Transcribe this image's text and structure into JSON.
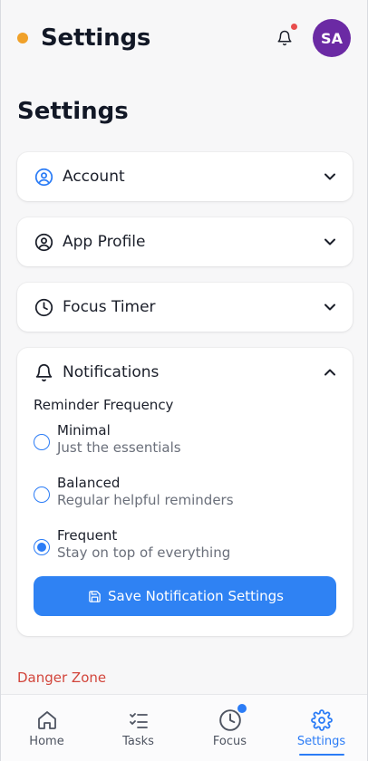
{
  "header": {
    "title": "Settings",
    "avatar_initials": "SA",
    "brand_dot_color": "#f0a12a",
    "notification_badge_color": "#e84d4d"
  },
  "page": {
    "title": "Settings"
  },
  "sections": {
    "account": {
      "label": "Account",
      "icon": "user-circle-icon"
    },
    "app_profile": {
      "label": "App Profile",
      "icon": "profile-icon"
    },
    "focus_timer": {
      "label": "Focus Timer",
      "icon": "clock-icon"
    },
    "notifications": {
      "label": "Notifications",
      "icon": "bell-icon",
      "frequency_label": "Reminder Frequency",
      "options": [
        {
          "title": "Minimal",
          "subtitle": "Just the essentials",
          "selected": false
        },
        {
          "title": "Balanced",
          "subtitle": "Regular helpful reminders",
          "selected": false
        },
        {
          "title": "Frequent",
          "subtitle": "Stay on top of everything",
          "selected": true
        }
      ],
      "save_label": "Save Notification Settings"
    }
  },
  "danger_zone": {
    "label": "Danger Zone"
  },
  "tabs": [
    {
      "label": "Home",
      "icon": "home-icon",
      "active": false
    },
    {
      "label": "Tasks",
      "icon": "tasks-icon",
      "active": false
    },
    {
      "label": "Focus",
      "icon": "clock-icon",
      "active": false
    },
    {
      "label": "Settings",
      "icon": "gear-icon",
      "active": true
    }
  ],
  "colors": {
    "accent": "#2f82f3",
    "danger": "#d2463c",
    "avatar_bg": "#6b2aa4"
  }
}
